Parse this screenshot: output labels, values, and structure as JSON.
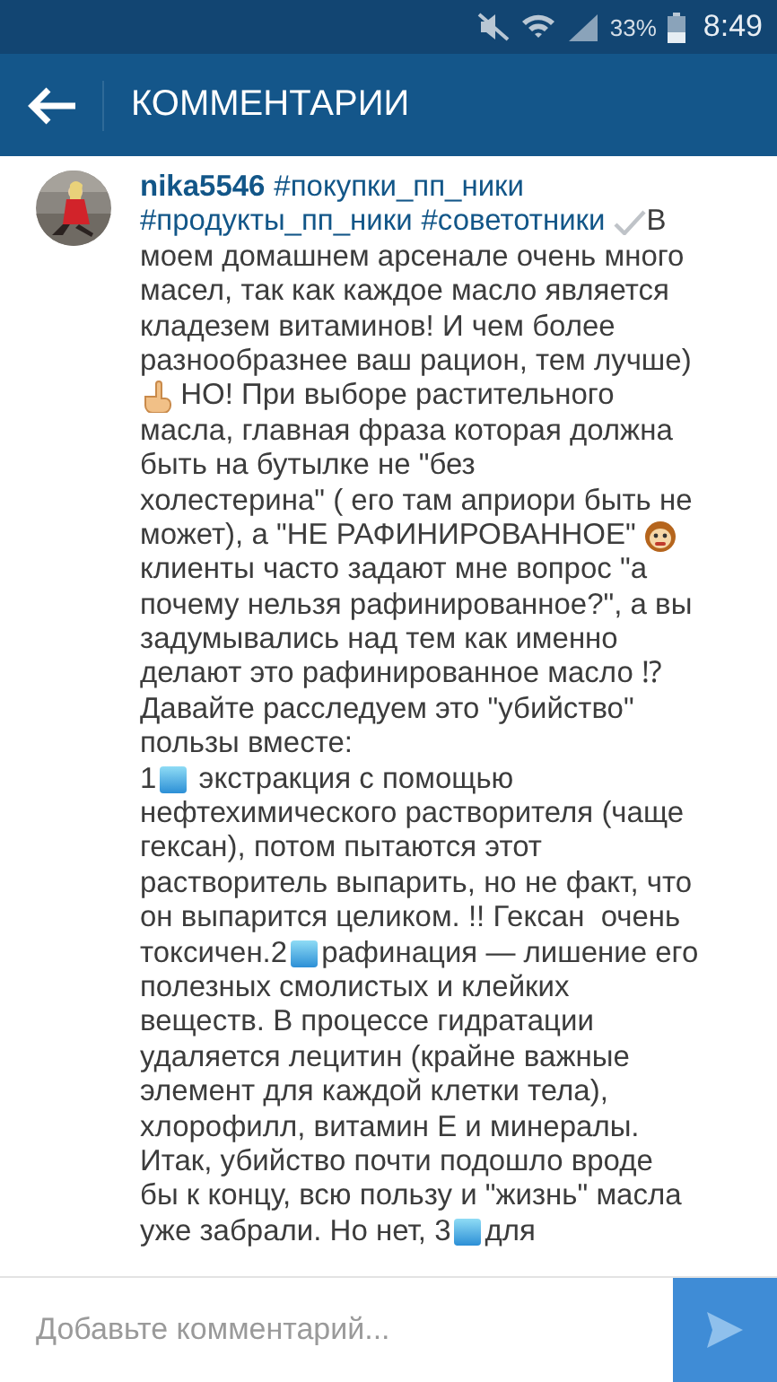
{
  "status_bar": {
    "battery_text": "33%",
    "time": "8:49"
  },
  "app_bar": {
    "title": "КОММЕНТАРИИ"
  },
  "comment": {
    "lines": [
      [
        {
          "kind": "user",
          "text": "nika5546"
        },
        {
          "kind": "tag",
          "text": "#покупки_пп_ники"
        }
      ],
      [
        {
          "kind": "tag",
          "text": "#продукты_пп_ники"
        },
        {
          "kind": "tag",
          "text": "#советотники"
        },
        {
          "kind": "check-mark"
        },
        {
          "kind": "text",
          "text": "В"
        }
      ],
      [
        {
          "kind": "text",
          "text": "моем домашнем арсенале очень много"
        }
      ],
      [
        {
          "kind": "text",
          "text": "масел, так как каждое масло является"
        }
      ],
      [
        {
          "kind": "text",
          "text": "кладезем витаминов! И чем более"
        }
      ],
      [
        {
          "kind": "text",
          "text": "разнообразнее ваш рацион, тем лучше)"
        }
      ],
      [
        {
          "kind": "pointing-hand"
        },
        {
          "kind": "text",
          "text": " НО! При выборе растительного"
        }
      ],
      [
        {
          "kind": "text",
          "text": "масла, главная фраза которая должна"
        }
      ],
      [
        {
          "kind": "text",
          "text": "быть на бутылке не \"без"
        }
      ],
      [
        {
          "kind": "text",
          "text": "холестерина\" ( его там априори быть не"
        }
      ],
      [
        {
          "kind": "text",
          "text": "может), а \"НЕ РАФИНИРОВАННОЕ\" "
        },
        {
          "kind": "monkey-face"
        }
      ],
      [
        {
          "kind": "text",
          "text": "клиенты часто задают мне вопрос \"а"
        }
      ],
      [
        {
          "kind": "text",
          "text": "почему нельзя рафинированное?\", а вы"
        }
      ],
      [
        {
          "kind": "text",
          "text": "задумывались над тем как именно"
        }
      ],
      [
        {
          "kind": "text",
          "text": "делают это рафинированное масло ⁉"
        }
      ],
      [
        {
          "kind": "text",
          "text": "Давайте расследуем это \"убийство\""
        }
      ],
      [
        {
          "kind": "text",
          "text": "пользы вместе:"
        }
      ],
      [
        {
          "kind": "text",
          "text": "1"
        },
        {
          "kind": "blue-square"
        },
        {
          "kind": "text",
          "text": " экстракция с помощью"
        }
      ],
      [
        {
          "kind": "text",
          "text": "нефтехимического растворителя (чаще"
        }
      ],
      [
        {
          "kind": "text",
          "text": "гексан), потом пытаются этот"
        }
      ],
      [
        {
          "kind": "text",
          "text": "растворитель выпарить, но не факт, что"
        }
      ],
      [
        {
          "kind": "text",
          "text": "он выпарится целиком. !! Гексан  очень"
        }
      ],
      [
        {
          "kind": "text",
          "text": "токсичен.2"
        },
        {
          "kind": "blue-square"
        },
        {
          "kind": "text",
          "text": "рафинация — лишение его"
        }
      ],
      [
        {
          "kind": "text",
          "text": "полезных смолистых и клейких"
        }
      ],
      [
        {
          "kind": "text",
          "text": "веществ. В процессе гидратации"
        }
      ],
      [
        {
          "kind": "text",
          "text": "удаляется лецитин (крайне важные"
        }
      ],
      [
        {
          "kind": "text",
          "text": "элемент для каждой клетки тела),"
        }
      ],
      [
        {
          "kind": "text",
          "text": "хлорофилл, витамин Е и минералы."
        }
      ],
      [
        {
          "kind": "text",
          "text": "Итак, убийство почти подошло вроде"
        }
      ],
      [
        {
          "kind": "text",
          "text": "бы к концу, всю пользу и \"жизнь\" масла"
        }
      ],
      [
        {
          "kind": "text",
          "text": "уже забрали. Но нет, 3"
        },
        {
          "kind": "blue-square"
        },
        {
          "kind": "text",
          "text": "для"
        }
      ]
    ]
  },
  "input": {
    "placeholder": "Добавьте комментарий..."
  }
}
